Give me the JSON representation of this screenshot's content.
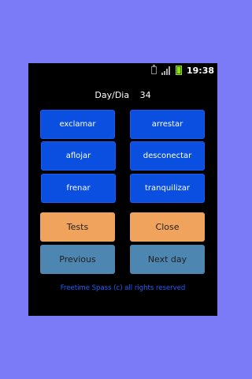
{
  "status_bar": {
    "time": "19:38",
    "icons": [
      "usb-icon",
      "signal-icon",
      "battery-icon"
    ]
  },
  "header": {
    "day_label": "Day/Dia",
    "day_number": "34"
  },
  "words": {
    "left": [
      "exclamar",
      "aflojar",
      "frenar"
    ],
    "right": [
      "arrestar",
      "desconectar",
      "tranquilizar"
    ]
  },
  "buttons": {
    "tests": "Tests",
    "close": "Close",
    "previous": "Previous",
    "next_day": "Next day"
  },
  "footer": {
    "text": "Freetime Spass (c) all rights reserved"
  },
  "colors": {
    "background": "#7b7bf7",
    "word_button": "#0a4fe0",
    "action_button": "#f0a35c",
    "nav_button": "#4d86b0",
    "footer_text": "#1a5fff"
  }
}
